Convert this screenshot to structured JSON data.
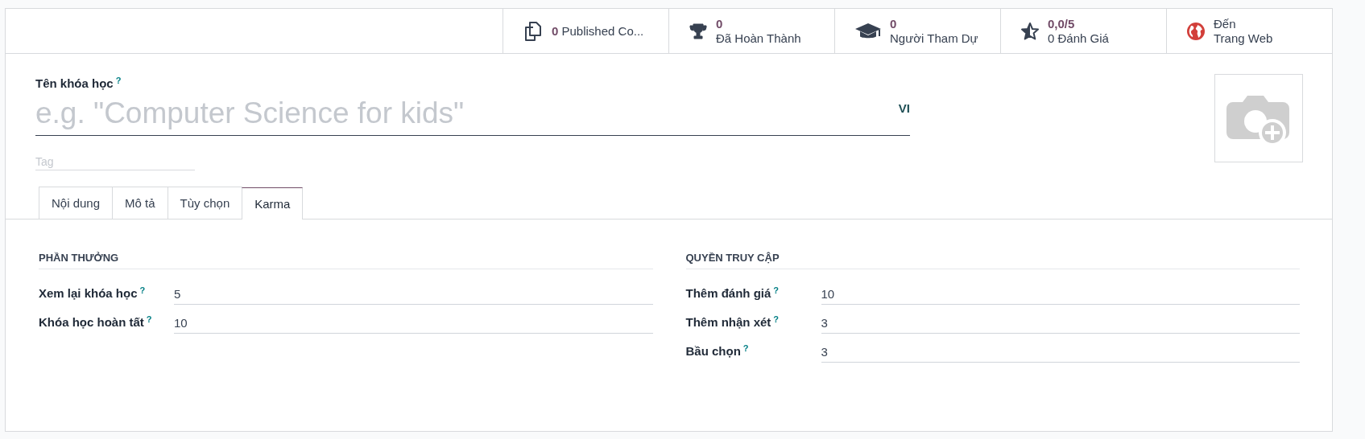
{
  "stat_buttons": [
    {
      "kind": "count",
      "value": "0",
      "label": "Published Co..."
    },
    {
      "kind": "stat",
      "value": "0",
      "label": "Đã Hoàn Thành"
    },
    {
      "kind": "stat",
      "value": "0",
      "label": "Người Tham Dự"
    },
    {
      "kind": "stat",
      "value": "0,0/5",
      "label": "0 Đánh Giá"
    },
    {
      "kind": "link",
      "value": "Đến",
      "label": "Trang Web"
    }
  ],
  "title_field": {
    "label": "Tên khóa học",
    "help": "?",
    "placeholder": "e.g. \"Computer Science for kids\"",
    "language": "VI"
  },
  "tag_field": {
    "placeholder": "Tag"
  },
  "tabs": [
    {
      "label": "Nội dung",
      "selected": false
    },
    {
      "label": "Mô tả",
      "selected": false
    },
    {
      "label": "Tùy chọn",
      "selected": false
    },
    {
      "label": "Karma",
      "selected": true
    }
  ],
  "sections": [
    {
      "title": "PHẦN THƯỞNG",
      "fields": [
        {
          "label": "Xem lại khóa học",
          "help": "?",
          "value": "5"
        },
        {
          "label": "Khóa học hoàn tất",
          "help": "?",
          "value": "10"
        }
      ]
    },
    {
      "title": "QUYỀN TRUY CẬP",
      "fields": [
        {
          "label": "Thêm đánh giá",
          "help": "?",
          "value": "10"
        },
        {
          "label": "Thêm nhận xét",
          "help": "?",
          "value": "3"
        },
        {
          "label": "Bầu chọn",
          "help": "?",
          "value": "3"
        }
      ]
    }
  ]
}
